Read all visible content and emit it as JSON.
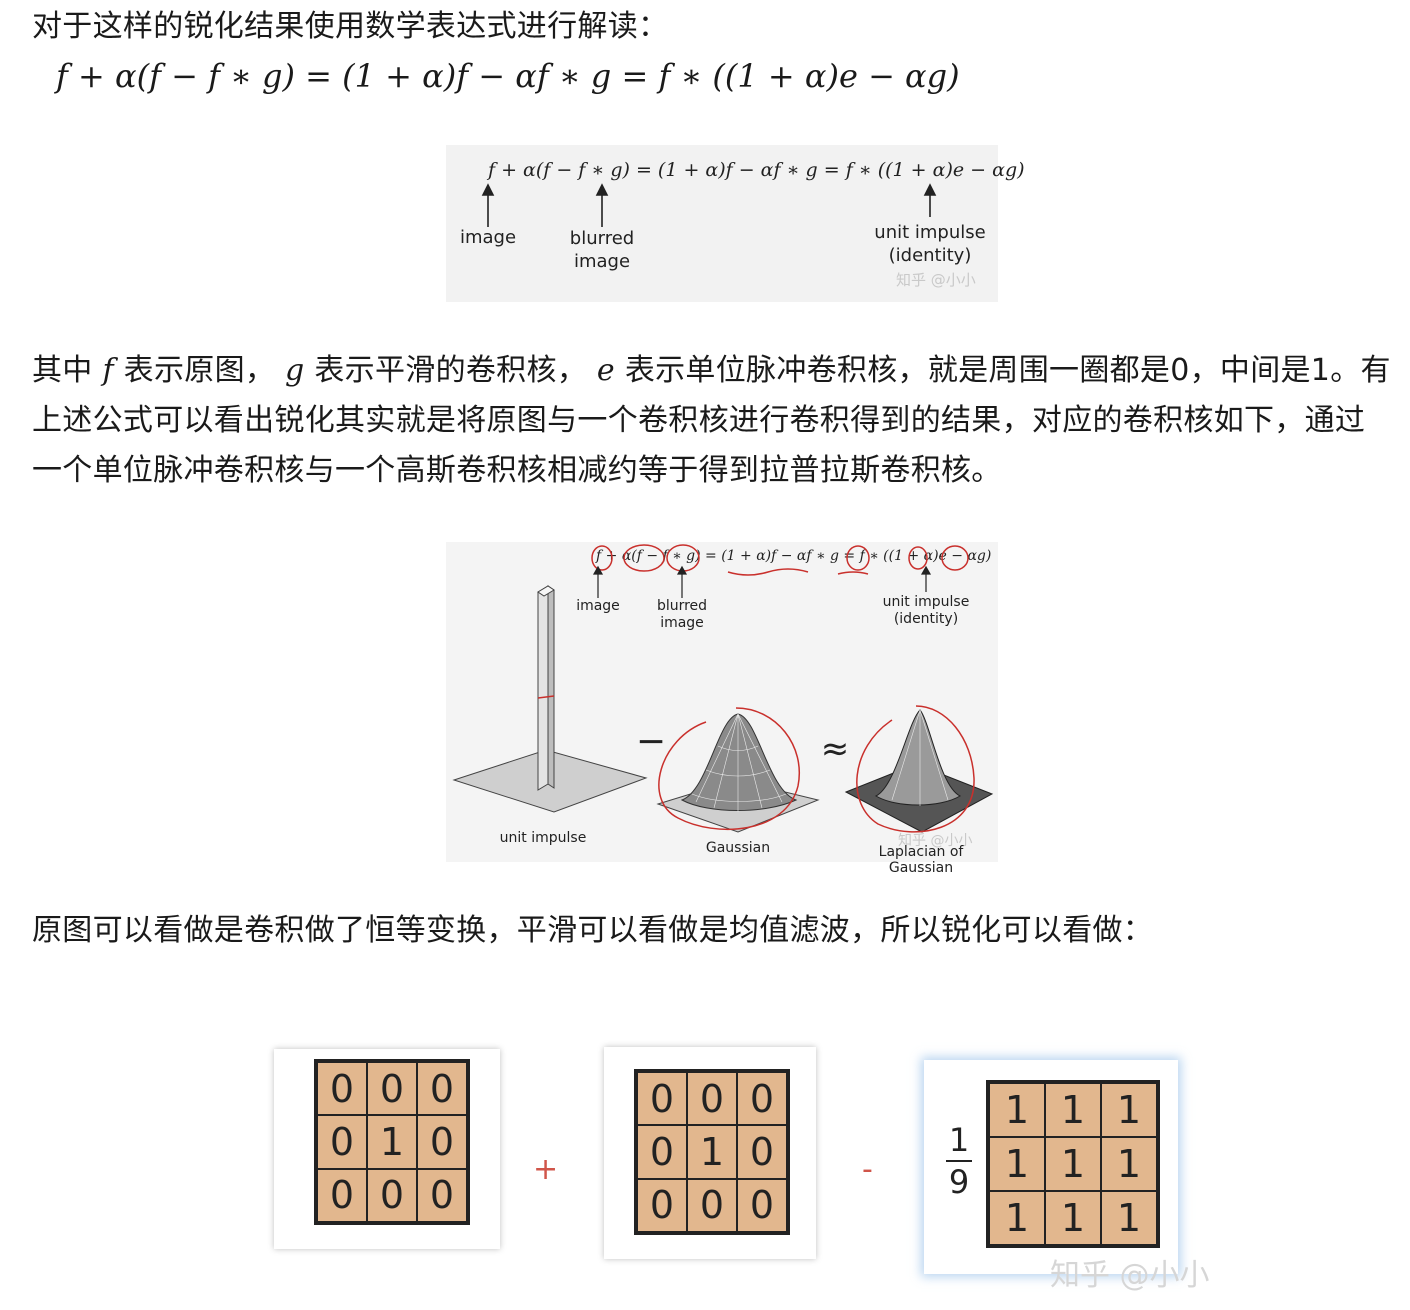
{
  "intro_text": "对于这样的锐化结果使用数学表达式进行解读：",
  "main_formula": "f + α(f − f ∗ g) = (1 + α)f − αf ∗ g = f ∗ ((1 + α)e − αg)",
  "figure1": {
    "formula": "f  + α(f − f ∗ g) = (1 + α)f − αf ∗ g = f ∗ ((1 + α)e − αg)",
    "labels": {
      "image": "image",
      "blurred_line1": "blurred",
      "blurred_line2": "image",
      "unit_line1": "unit impulse",
      "unit_line2": "(identity)"
    },
    "watermark": "知乎 @小小"
  },
  "para2": {
    "t1": "其中 ",
    "f": "f",
    "t2": " 表示原图， ",
    "g": "g",
    "t3": " 表示平滑的卷积核， ",
    "e": "e",
    "t4": " 表示单位脉冲卷积核，就是周围一圈都是0，中间是1。有上述公式可以看出锐化其实就是将原图与一个卷积核进行卷积得到的结果，对应的卷积核如下，通过一个单位脉冲卷积核与一个高斯卷积核相减约等于得到拉普拉斯卷积核。"
  },
  "figure2": {
    "formula": "f + α(f − f ∗ g) = (1 + α)f − αf ∗ g = f ∗ ((1 + α)e − αg)",
    "labels": {
      "image": "image",
      "blurred_line1": "blurred",
      "blurred_line2": "image",
      "unit_line1": "unit impulse",
      "unit_line2": "(identity)",
      "unit_impulse": "unit impulse",
      "gaussian": "Gaussian",
      "log": "Laplacian of Gaussian"
    },
    "minus": "−",
    "approx": "≈",
    "watermark": "知乎 @小小"
  },
  "para3": "原图可以看做是卷积做了恒等变换，平滑可以看做是均值滤波，所以锐化可以看做：",
  "figure3": {
    "matrix1": [
      "0",
      "0",
      "0",
      "0",
      "1",
      "0",
      "0",
      "0",
      "0"
    ],
    "matrix2": [
      "0",
      "0",
      "0",
      "0",
      "1",
      "0",
      "0",
      "0",
      "0"
    ],
    "matrix3": [
      "1",
      "1",
      "1",
      "1",
      "1",
      "1",
      "1",
      "1",
      "1"
    ],
    "plus": "+",
    "minus": "-",
    "frac_num": "1",
    "frac_den": "9",
    "watermark": "知乎 @小小",
    "colors": {
      "cell": "#e2b78e",
      "operator": "#d0554a",
      "highlight": "#9cc3ea"
    }
  }
}
